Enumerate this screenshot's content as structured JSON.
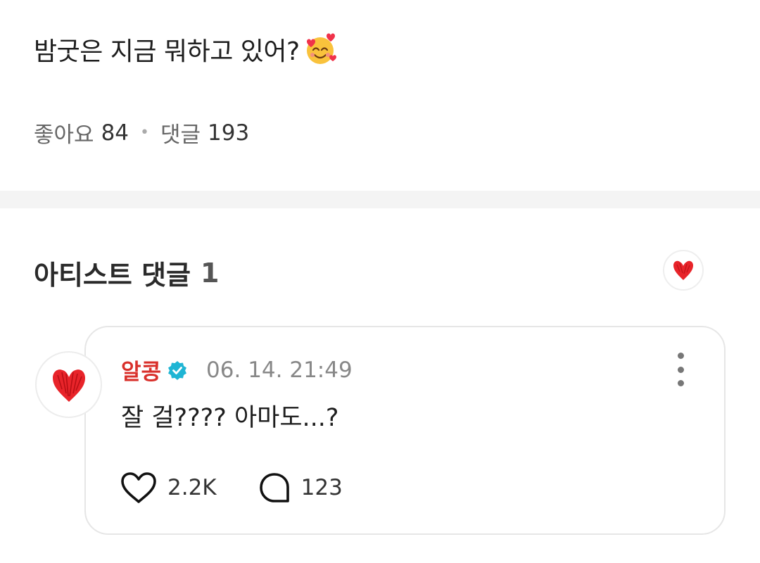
{
  "post": {
    "title": "밤굿은 지금 뭐하고 있어?",
    "emoji": "smiling-face-with-hearts",
    "likes_label": "좋아요",
    "likes_count": "84",
    "comments_label": "댓글",
    "comments_count": "193"
  },
  "artist_section": {
    "title": "아티스트 댓글",
    "count": "1"
  },
  "comment": {
    "author": "알콩",
    "timestamp": "06. 14. 21:49",
    "text": "잘 걸???? 아마도...?",
    "likes": "2.2K",
    "replies": "123"
  },
  "colors": {
    "accent_red": "#d9302b",
    "verified": "#1fb5d4",
    "heart_red": "#e8242a"
  }
}
